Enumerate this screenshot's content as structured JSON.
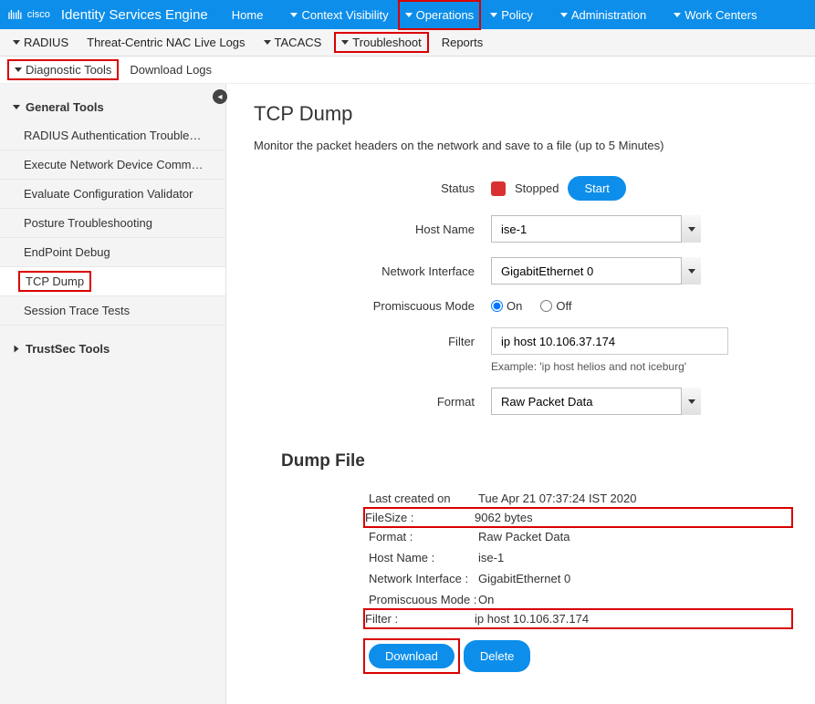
{
  "brand": "Identity Services Engine",
  "topNav": {
    "home": "Home",
    "context": "Context Visibility",
    "operations": "Operations",
    "policy": "Policy",
    "administration": "Administration",
    "work": "Work Centers"
  },
  "subNav": {
    "radius": "RADIUS",
    "threat": "Threat-Centric NAC Live Logs",
    "tacacs": "TACACS",
    "troubleshoot": "Troubleshoot",
    "reports": "Reports"
  },
  "terNav": {
    "diag": "Diagnostic Tools",
    "download": "Download Logs"
  },
  "sidebar": {
    "general": "General Tools",
    "items": [
      "RADIUS Authentication Trouble…",
      "Execute Network Device Comm…",
      "Evaluate Configuration Validator",
      "Posture Troubleshooting",
      "EndPoint Debug",
      "TCP Dump",
      "Session Trace Tests"
    ],
    "trustsec": "TrustSec Tools"
  },
  "page": {
    "title": "TCP Dump",
    "desc": "Monitor the packet headers on the network and save to a file (up to 5 Minutes)"
  },
  "form": {
    "statusLabel": "Status",
    "statusValue": "Stopped",
    "startBtn": "Start",
    "hostLabel": "Host Name",
    "hostValue": "ise-1",
    "ifaceLabel": "Network Interface",
    "ifaceValue": "GigabitEthernet 0",
    "promLabel": "Promiscuous Mode",
    "on": "On",
    "off": "Off",
    "filterLabel": "Filter",
    "filterValue": "ip host 10.106.37.174",
    "filterHint": "Example: 'ip host helios and not iceburg'",
    "formatLabel": "Format",
    "formatValue": "Raw Packet Data"
  },
  "dump": {
    "title": "Dump File",
    "rows": {
      "createdLabel": "Last created on",
      "createdValue": "Tue Apr 21 07:37:24 IST 2020",
      "sizeLabel": "FileSize :",
      "sizeValue": "9062 bytes",
      "formatLabel": "Format :",
      "formatValue": "Raw Packet Data",
      "hostLabel": "Host Name :",
      "hostValue": "ise-1",
      "ifaceLabel": "Network Interface :",
      "ifaceValue": "GigabitEthernet 0",
      "promLabel": "Promiscuous Mode :",
      "promValue": "On",
      "filterLabel": "Filter :",
      "filterValue": "ip host 10.106.37.174"
    },
    "downloadBtn": "Download",
    "deleteBtn": "Delete"
  }
}
